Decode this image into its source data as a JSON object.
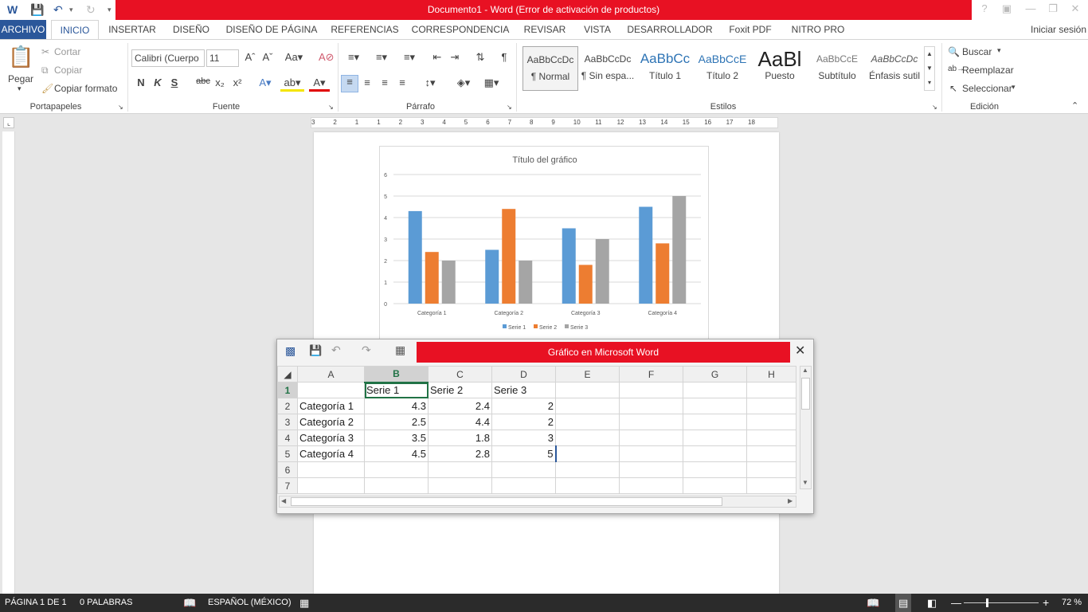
{
  "app": {
    "title": "Documento1 -  Word (Error de activación de productos)",
    "signin": "Iniciar sesión",
    "accent": "#2b579a",
    "alert_red": "#e81123"
  },
  "tabs": [
    "ARCHIVO",
    "INICIO",
    "INSERTAR",
    "DISEÑO",
    "DISEÑO DE PÁGINA",
    "REFERENCIAS",
    "CORRESPONDENCIA",
    "REVISAR",
    "VISTA",
    "DESARROLLADOR",
    "Foxit PDF",
    "NITRO PRO"
  ],
  "ribbon": {
    "clipboard": {
      "paste": "Pegar",
      "cut": "Cortar",
      "copy": "Copiar",
      "format_painter": "Copiar formato",
      "group": "Portapapeles"
    },
    "font": {
      "name": "Calibri (Cuerpo",
      "size": "11",
      "group": "Fuente",
      "bold": "N",
      "italic": "K",
      "underline": "S",
      "strike": "abc",
      "sub": "x₂",
      "sup": "x²"
    },
    "paragraph": {
      "group": "Párrafo"
    },
    "styles": {
      "group": "Estilos",
      "items": [
        {
          "preview": "AaBbCcDc",
          "label": "¶ Normal"
        },
        {
          "preview": "AaBbCcDc",
          "label": "¶ Sin espa..."
        },
        {
          "preview": "AaBbCc",
          "label": "Título 1"
        },
        {
          "preview": "AaBbCcE",
          "label": "Título 2"
        },
        {
          "preview": "AaBl",
          "label": "Puesto"
        },
        {
          "preview": "AaBbCcE",
          "label": "Subtítulo"
        },
        {
          "preview": "AaBbCcDc",
          "label": "Énfasis sutil"
        }
      ]
    },
    "editing": {
      "find": "Buscar",
      "replace": "Reemplazar",
      "select": "Seleccionar",
      "group": "Edición"
    }
  },
  "ruler_numbers": [
    "3",
    "2",
    "1",
    "1",
    "2",
    "3",
    "4",
    "5",
    "6",
    "7",
    "8",
    "9",
    "10",
    "11",
    "12",
    "13",
    "14",
    "15",
    "16",
    "17",
    "18"
  ],
  "chart_data": {
    "type": "bar",
    "title": "Título del gráfico",
    "categories": [
      "Categoría 1",
      "Categoría 2",
      "Categoría 3",
      "Categoría 4"
    ],
    "series": [
      {
        "name": "Serie 1",
        "values": [
          4.3,
          2.5,
          3.5,
          4.5
        ],
        "color": "#5b9bd5"
      },
      {
        "name": "Serie 2",
        "values": [
          2.4,
          4.4,
          1.8,
          2.8
        ],
        "color": "#ed7d31"
      },
      {
        "name": "Serie 3",
        "values": [
          2,
          2,
          3,
          5
        ],
        "color": "#a5a5a5"
      }
    ],
    "yticks": [
      "0",
      "1",
      "2",
      "3",
      "4",
      "5",
      "6"
    ],
    "ylim": [
      0,
      6
    ],
    "grid": true,
    "legend": "bottom"
  },
  "sheet": {
    "title": "Gráfico en Microsoft Word",
    "columns": [
      "A",
      "B",
      "C",
      "D",
      "E",
      "F",
      "G",
      "H"
    ],
    "rows": [
      [
        "1",
        "",
        "Serie 1",
        "Serie 2",
        "Serie 3",
        "",
        "",
        "",
        ""
      ],
      [
        "2",
        "Categoría 1",
        "4.3",
        "2.4",
        "2",
        "",
        "",
        "",
        ""
      ],
      [
        "3",
        "Categoría 2",
        "2.5",
        "4.4",
        "2",
        "",
        "",
        "",
        ""
      ],
      [
        "4",
        "Categoría 3",
        "3.5",
        "1.8",
        "3",
        "",
        "",
        "",
        ""
      ],
      [
        "5",
        "Categoría 4",
        "4.5",
        "2.8",
        "5",
        "",
        "",
        "",
        ""
      ],
      [
        "6",
        "",
        "",
        "",
        "",
        "",
        "",
        "",
        ""
      ],
      [
        "7",
        "",
        "",
        "",
        "",
        "",
        "",
        "",
        ""
      ]
    ]
  },
  "status": {
    "page": "PÁGINA 1 DE 1",
    "words": "0 PALABRAS",
    "language": "ESPAÑOL (MÉXICO)",
    "zoom": "72 %"
  }
}
